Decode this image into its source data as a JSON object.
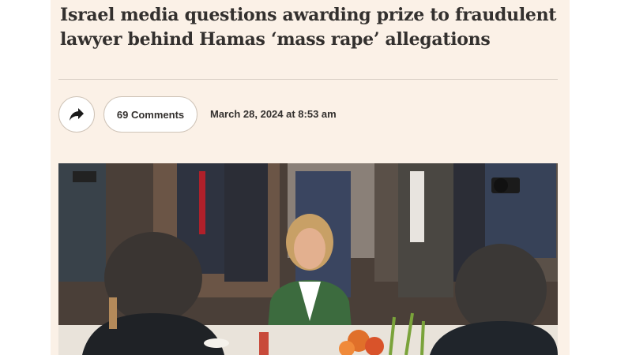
{
  "article": {
    "headline": "Israel media questions awarding prize to fraudulent lawyer behind Hamas ‘mass rape’ allegations",
    "comments_label": "69 Comments",
    "date": "March 28, 2024 at 8:53 am",
    "share_icon": "share-arrow-icon"
  },
  "colors": {
    "card_background": "#fbf1e7",
    "text": "#33302e",
    "divider": "#d6ccc2",
    "button_border": "#cfc4b8"
  }
}
